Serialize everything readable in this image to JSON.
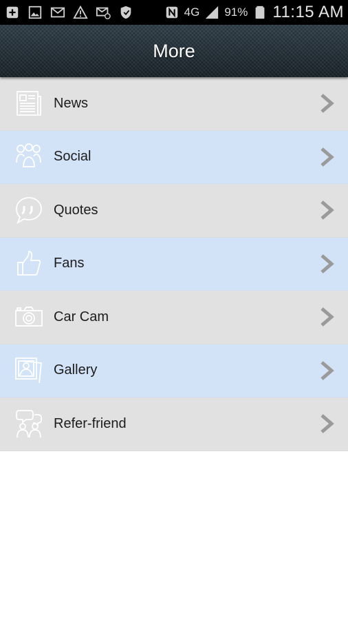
{
  "status_bar": {
    "left_icons": [
      "add-icon",
      "image-icon",
      "gmail-icon",
      "warning-icon",
      "email-icon",
      "shield-icon"
    ],
    "right_icons": [
      "nfc-icon",
      "network-4g-icon",
      "signal-icon"
    ],
    "network": "4G",
    "battery": "91%",
    "time": "11:15 AM"
  },
  "header": {
    "title": "More"
  },
  "menu": {
    "items": [
      {
        "label": "News",
        "icon": "newspaper-icon"
      },
      {
        "label": "Social",
        "icon": "people-icon"
      },
      {
        "label": "Quotes",
        "icon": "quote-bubble-icon"
      },
      {
        "label": "Fans",
        "icon": "thumbs-up-icon"
      },
      {
        "label": "Car Cam",
        "icon": "camera-icon"
      },
      {
        "label": "Gallery",
        "icon": "gallery-icon"
      },
      {
        "label": "Refer-friend",
        "icon": "refer-friend-icon"
      }
    ]
  },
  "colors": {
    "row_gray": "#e1e1e1",
    "row_blue": "#d3e3f7",
    "header_bg": "#24313a",
    "chevron": "#9a9a9a"
  }
}
